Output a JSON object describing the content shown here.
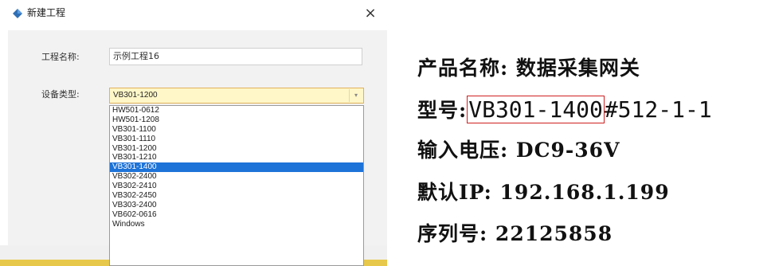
{
  "dialog": {
    "title": "新建工程",
    "close_glyph": "×",
    "name_label": "工程名称:",
    "name_value": "示例工程16",
    "type_label": "设备类型:",
    "type_selected": "VB301-1200",
    "dropdown_options": [
      "HW501-0612",
      "HW501-1208",
      "VB301-1100",
      "VB301-1110",
      "VB301-1200",
      "VB301-1210",
      "VB301-1400",
      "VB302-2400",
      "VB302-2410",
      "VB302-2450",
      "VB303-2400",
      "VB602-0616",
      "Windows"
    ],
    "highlighted_option": "VB301-1400",
    "icons": {
      "title": "diamond-app-icon",
      "close": "close-icon",
      "dropdown": "chevron-down-icon"
    }
  },
  "product": {
    "name_line": "产品名称: 数据采集网关",
    "model_prefix": "型号:",
    "model_boxed": "VB301-1400",
    "model_suffix": "#512-1-1",
    "voltage_line": "输入电压: DC9-36V",
    "ip_line": "默认IP: 192.168.1.199",
    "serial_line": "序列号: 22125858"
  },
  "colors": {
    "highlight": "#1e73d8",
    "select_bg": "#fff7c8",
    "model_box_border": "#d02020",
    "accent_strip": "#e8c84a"
  }
}
